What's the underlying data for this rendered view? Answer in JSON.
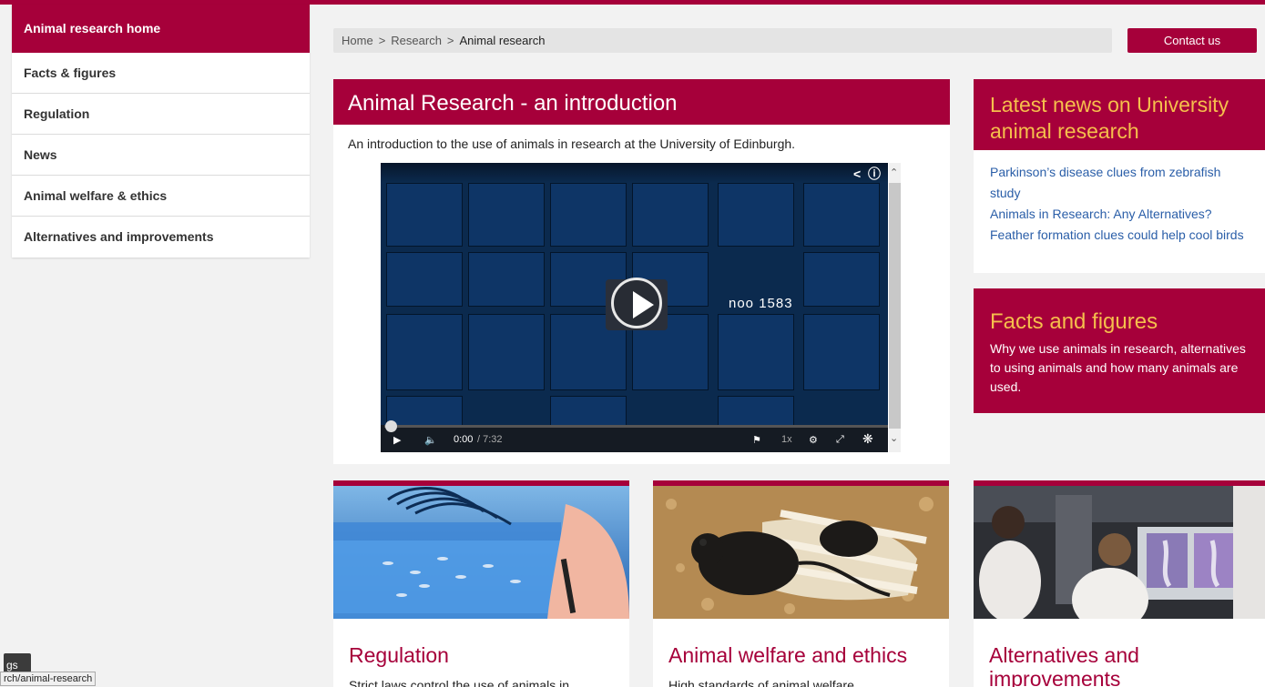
{
  "sidebar": {
    "items": [
      {
        "label": "Animal research home"
      },
      {
        "label": "Facts & figures"
      },
      {
        "label": "Regulation"
      },
      {
        "label": "News"
      },
      {
        "label": "Animal welfare & ethics"
      },
      {
        "label": "Alternatives and improvements"
      }
    ]
  },
  "breadcrumb": {
    "home": "Home",
    "sep": ">",
    "research": "Research",
    "current": "Animal research"
  },
  "header": {
    "contact_label": "Contact us"
  },
  "intro": {
    "title": "Animal Research - an introduction",
    "description": "An introduction to the use of animals in research at the University of Edinburgh.",
    "video": {
      "frame_text": "noo 1583",
      "current_time": "0:00",
      "duration": "/ 7:32",
      "speed": "1x",
      "icons": [
        "share-icon",
        "info-icon",
        "play-icon",
        "volume-icon",
        "flag-icon",
        "settings-icon",
        "fullscreen-icon",
        "crest-icon"
      ]
    }
  },
  "news": {
    "title": "Latest news on University animal research",
    "links": [
      {
        "label": "Parkinson’s disease clues from zebrafish study"
      },
      {
        "label": "Animals in Research: Any Alternatives?"
      },
      {
        "label": "Feather formation clues could help cool birds"
      }
    ]
  },
  "facts": {
    "title": "Facts and figures",
    "text": "Why we use animals in research, alternatives to using animals and how many animals are used."
  },
  "cards": [
    {
      "title": "Regulation",
      "text": "Strict laws control the use of animals in"
    },
    {
      "title": "Animal welfare and ethics",
      "text": "High standards of animal welfare"
    },
    {
      "title": "Alternatives and improvements",
      "text": ""
    }
  ],
  "status": {
    "tab_label": "gs",
    "url": "rch/animal-research"
  },
  "colors": {
    "brand": "#a6003a",
    "accent": "#f5bf4c",
    "link": "#2a5ea8"
  }
}
